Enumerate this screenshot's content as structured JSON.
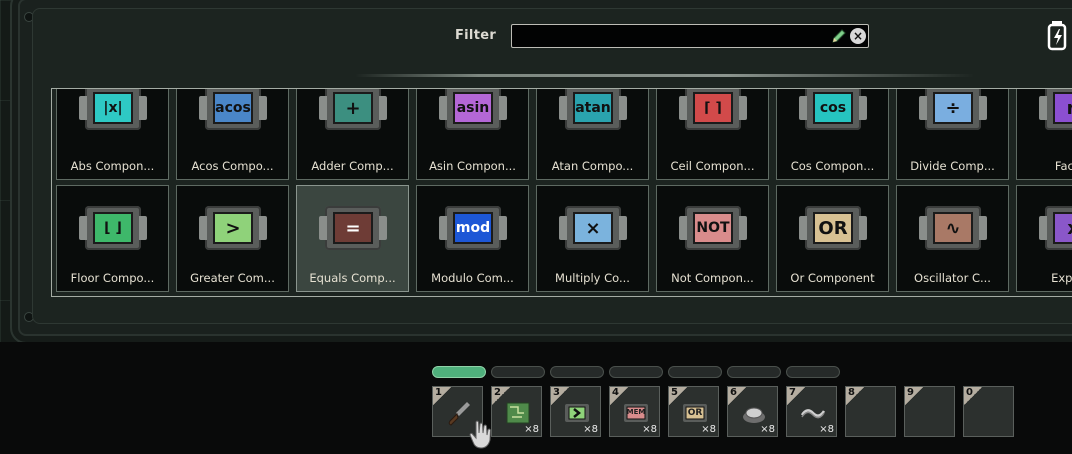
{
  "filter": {
    "label": "Filter",
    "value": ""
  },
  "components": [
    {
      "label": "Abs Compon...",
      "icon": "abs-icon",
      "glyph": "|x|",
      "color": "#2ec9c4"
    },
    {
      "label": "Acos Compo...",
      "icon": "acos-icon",
      "glyph": "acos",
      "color": "#4a86c8"
    },
    {
      "label": "Adder Comp...",
      "icon": "adder-icon",
      "glyph": "+",
      "color": "#3c8f80"
    },
    {
      "label": "Asin Compon...",
      "icon": "asin-icon",
      "glyph": "asin",
      "color": "#b467d6"
    },
    {
      "label": "Atan Compo...",
      "icon": "atan-icon",
      "glyph": "atan",
      "color": "#2aa3ae"
    },
    {
      "label": "Ceil Compon...",
      "icon": "ceil-icon",
      "glyph": "⌈ ⌉",
      "color": "#d24a4a"
    },
    {
      "label": "Cos Compon...",
      "icon": "cos-icon",
      "glyph": "cos",
      "color": "#26c4c0"
    },
    {
      "label": "Divide Comp...",
      "icon": "divide-icon",
      "glyph": "÷",
      "color": "#7aaee0"
    },
    {
      "label": "Factor",
      "icon": "factorial-icon",
      "glyph": "n",
      "color": "#8b4fd1"
    },
    {
      "label": "Floor Compo...",
      "icon": "floor-icon",
      "glyph": "⌊ ⌋",
      "color": "#3eb86a"
    },
    {
      "label": "Greater Com...",
      "icon": "greater-icon",
      "glyph": ">",
      "color": "#8fd27a"
    },
    {
      "label": "Equals Comp...",
      "icon": "equals-icon",
      "glyph": "=",
      "color": "#6e3c36"
    },
    {
      "label": "Modulo Com...",
      "icon": "modulo-icon",
      "glyph": "mod",
      "color": "#1d57d6"
    },
    {
      "label": "Multiply Co...",
      "icon": "multiply-icon",
      "glyph": "×",
      "color": "#7bb3dd"
    },
    {
      "label": "Not Compon...",
      "icon": "not-icon",
      "glyph": "NOT",
      "color": "#d98c8c"
    },
    {
      "label": "Or Component",
      "icon": "or-icon",
      "glyph": "OR",
      "color": "#d8c193"
    },
    {
      "label": "Oscillator C...",
      "icon": "oscillator-icon",
      "glyph": "∿",
      "color": "#a97966"
    },
    {
      "label": "Expone",
      "icon": "exponent-icon",
      "glyph": "x",
      "color": "#8a57c9"
    }
  ],
  "hotbar": {
    "tabs": [
      "tab1",
      "tab2",
      "tab3",
      "tab4",
      "tab5",
      "tab6",
      "tab7"
    ],
    "active_tab": 0,
    "slots": [
      {
        "num": "1",
        "icon": "screwdriver-icon",
        "count": ""
      },
      {
        "num": "2",
        "icon": "circuit-board-icon",
        "count": "×8"
      },
      {
        "num": "3",
        "icon": "greater-chip-icon",
        "count": "×8"
      },
      {
        "num": "4",
        "icon": "memory-chip-icon",
        "count": "×8"
      },
      {
        "num": "5",
        "icon": "or-chip-icon",
        "count": "×8"
      },
      {
        "num": "6",
        "icon": "button-icon",
        "count": "×8"
      },
      {
        "num": "7",
        "icon": "wire-icon",
        "count": "×8"
      },
      {
        "num": "8",
        "icon": "",
        "count": ""
      },
      {
        "num": "9",
        "icon": "",
        "count": ""
      },
      {
        "num": "0",
        "icon": "",
        "count": ""
      }
    ],
    "mem_text": "MEM",
    "or_text": "OR"
  }
}
